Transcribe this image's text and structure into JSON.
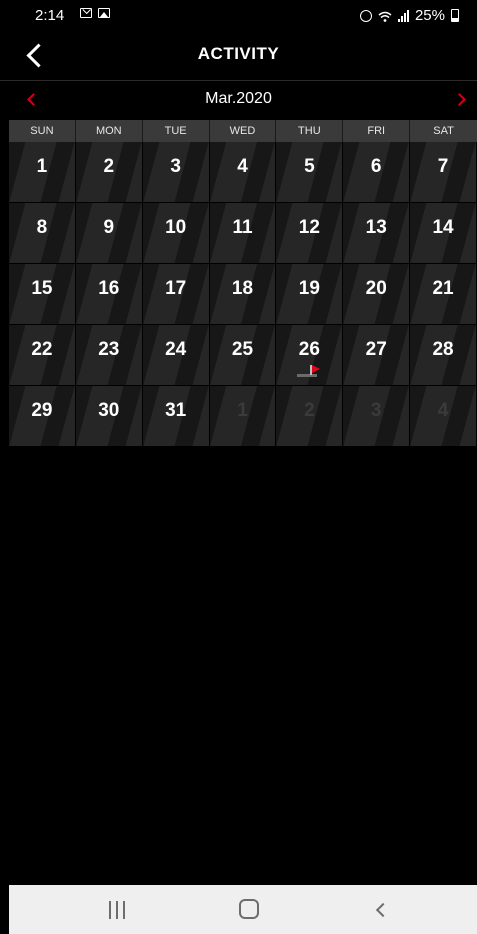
{
  "status_bar": {
    "time": "2:14",
    "battery": "25%",
    "icons_left": [
      "mail-icon",
      "image-icon"
    ],
    "icons_right": [
      "alarm-icon",
      "wifi-icon",
      "signal-icon",
      "battery-icon"
    ]
  },
  "header": {
    "title": "ACTIVITY",
    "back_icon": "chevron-left-icon"
  },
  "calendar": {
    "month_label": "Mar.2020",
    "accent_color": "#d0021b",
    "weekdays": [
      "SUN",
      "MON",
      "TUE",
      "WED",
      "THU",
      "FRI",
      "SAT"
    ],
    "weeks": [
      [
        {
          "d": "1"
        },
        {
          "d": "2"
        },
        {
          "d": "3"
        },
        {
          "d": "4"
        },
        {
          "d": "5"
        },
        {
          "d": "6"
        },
        {
          "d": "7"
        }
      ],
      [
        {
          "d": "8"
        },
        {
          "d": "9"
        },
        {
          "d": "10"
        },
        {
          "d": "11"
        },
        {
          "d": "12"
        },
        {
          "d": "13"
        },
        {
          "d": "14"
        }
      ],
      [
        {
          "d": "15"
        },
        {
          "d": "16"
        },
        {
          "d": "17"
        },
        {
          "d": "18"
        },
        {
          "d": "19"
        },
        {
          "d": "20"
        },
        {
          "d": "21"
        }
      ],
      [
        {
          "d": "22"
        },
        {
          "d": "23"
        },
        {
          "d": "24"
        },
        {
          "d": "25"
        },
        {
          "d": "26",
          "flag": true
        },
        {
          "d": "27"
        },
        {
          "d": "28"
        }
      ],
      [
        {
          "d": "29"
        },
        {
          "d": "30"
        },
        {
          "d": "31"
        },
        {
          "d": "1",
          "other": true
        },
        {
          "d": "2",
          "other": true
        },
        {
          "d": "3",
          "other": true
        },
        {
          "d": "4",
          "other": true
        }
      ]
    ]
  },
  "nav_bar": {
    "buttons": [
      "recents-icon",
      "home-icon",
      "back-icon"
    ]
  }
}
